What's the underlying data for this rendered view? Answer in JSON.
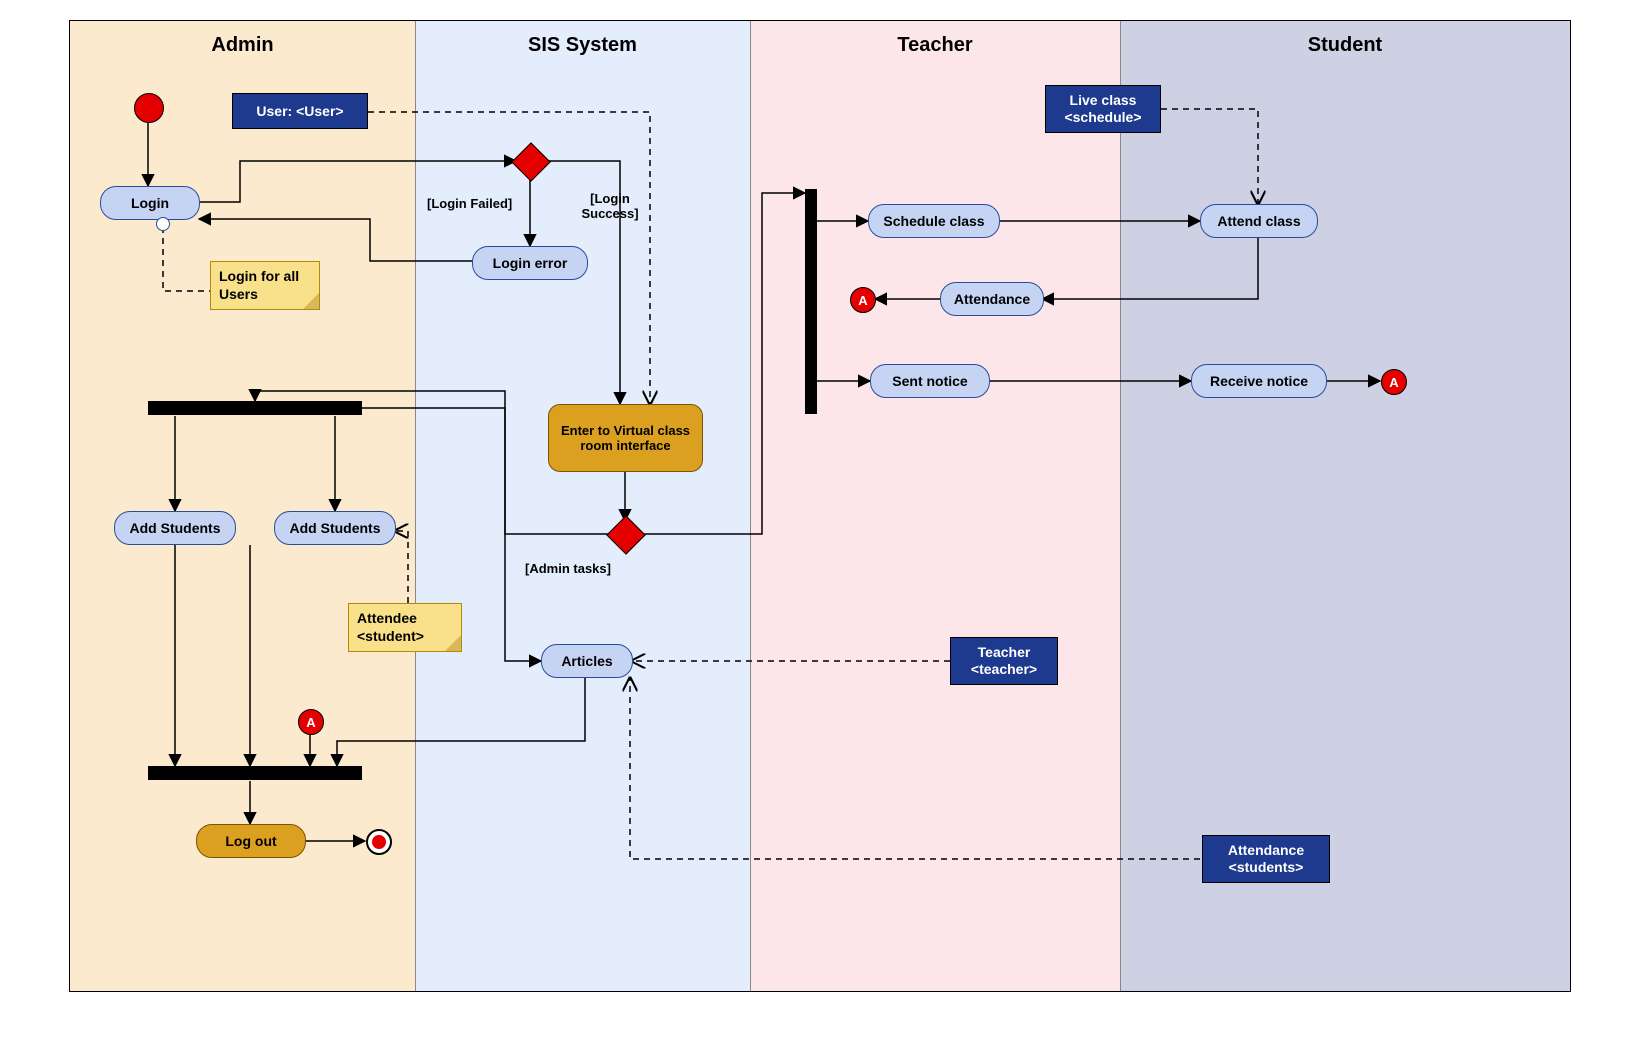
{
  "lanes": {
    "admin": {
      "title": "Admin"
    },
    "sis": {
      "title": "SIS System"
    },
    "teacher": {
      "title": "Teacher"
    },
    "student": {
      "title": "Student"
    }
  },
  "activities": {
    "login": "Login",
    "login_error": "Login error",
    "add_students_1": "Add Students",
    "add_students_2": "Add Students",
    "logout": "Log out",
    "vclass": "Enter to Virtual class room interface",
    "articles": "Articles",
    "schedule_class": "Schedule class",
    "attendance": "Attendance",
    "sent_notice": "Sent notice",
    "attend_class": "Attend class",
    "receive_notice": "Receive notice"
  },
  "objects": {
    "user": "User: <User>",
    "live_class": "Live class <schedule>",
    "teacher_obj": "Teacher <teacher>",
    "att_students": "Attendance <students>"
  },
  "notes": {
    "login_all": "Login for all Users",
    "attendee": "Attendee <student>"
  },
  "guards": {
    "login_failed": "[Login Failed]",
    "login_success": "[Login Success]",
    "admin_tasks": "[Admin tasks]"
  },
  "connectors": {
    "a": "A"
  }
}
